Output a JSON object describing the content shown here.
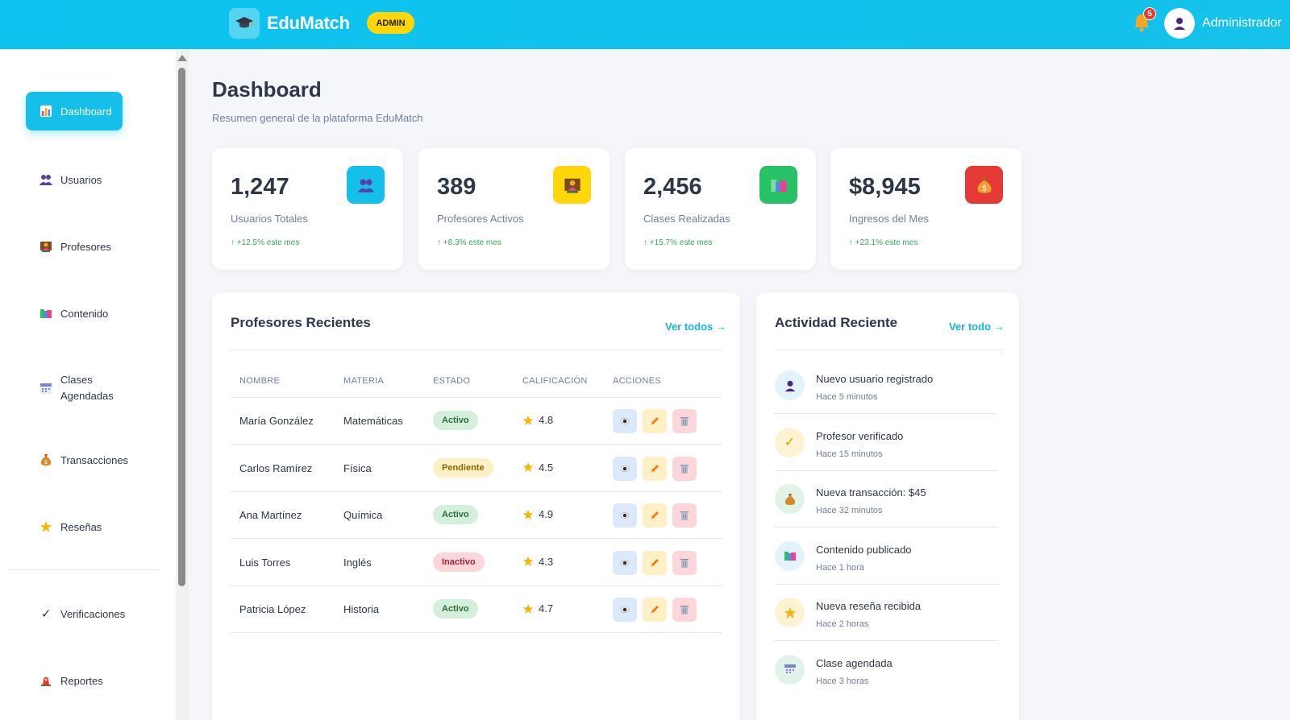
{
  "header": {
    "brand": "EduMatch",
    "badge": "ADMIN",
    "notifications_count": "5",
    "user_name": "Administrador"
  },
  "sidebar": {
    "items": [
      {
        "label": "Dashboard",
        "icon": "chart-icon",
        "active": true
      },
      {
        "label": "Usuarios",
        "icon": "users-icon"
      },
      {
        "label": "Profesores",
        "icon": "teacher-icon"
      },
      {
        "label": "Contenido",
        "icon": "books-icon"
      },
      {
        "label": "Clases\nAgendadas",
        "icon": "calendar-icon"
      },
      {
        "label": "Transacciones",
        "icon": "money-bag-icon"
      },
      {
        "label": "Reseñas",
        "icon": "star-icon"
      },
      {
        "label": "Verificaciones",
        "icon": "check-icon"
      },
      {
        "label": "Reportes",
        "icon": "alert-icon"
      }
    ]
  },
  "page": {
    "title": "Dashboard",
    "subtitle": "Resumen general de la plataforma EduMatch"
  },
  "stats": [
    {
      "value": "1,247",
      "label": "Usuarios Totales",
      "trend": "↑ +12.5% este mes",
      "color": "#14c0ea",
      "icon": "users-icon"
    },
    {
      "value": "389",
      "label": "Profesores Activos",
      "trend": "↑ +8.3% este mes",
      "color": "#ffd60a",
      "icon": "teacher-icon"
    },
    {
      "value": "2,456",
      "label": "Clases Realizadas",
      "trend": "↑ +15.7% este mes",
      "color": "#27c266",
      "icon": "books-icon"
    },
    {
      "value": "$8,945",
      "label": "Ingresos del Mes",
      "trend": "↑ +23.1% este mes",
      "color": "#e53935",
      "icon": "money-bag-icon"
    }
  ],
  "teachers": {
    "title": "Profesores Recientes",
    "link": "Ver todos →",
    "columns": [
      "NOMBRE",
      "MATERIA",
      "ESTADO",
      "CALIFICACIÓN",
      "ACCIONES"
    ],
    "rows": [
      {
        "name": "María González",
        "subject": "Matemáticas",
        "status": "Activo",
        "status_type": "active",
        "rating": "4.8"
      },
      {
        "name": "Carlos Ramírez",
        "subject": "Física",
        "status": "Pendiente",
        "status_type": "pending",
        "rating": "4.5"
      },
      {
        "name": "Ana Martínez",
        "subject": "Química",
        "status": "Activo",
        "status_type": "active",
        "rating": "4.9"
      },
      {
        "name": "Luis Torres",
        "subject": "Inglés",
        "status": "Inactivo",
        "status_type": "inactive",
        "rating": "4.3"
      },
      {
        "name": "Patricia López",
        "subject": "Historia",
        "status": "Activo",
        "status_type": "active",
        "rating": "4.7"
      }
    ]
  },
  "activity": {
    "title": "Actividad Reciente",
    "link": "Ver todo →",
    "items": [
      {
        "title": "Nuevo usuario registrado",
        "time": "Hace 5 minutos",
        "icon": "user-icon",
        "bg": "#e3f2fb"
      },
      {
        "title": "Profesor verificado",
        "time": "Hace 15 minutos",
        "icon": "check-icon",
        "bg": "#fdf3d3"
      },
      {
        "title": "Nueva transacción: $45",
        "time": "Hace 32 minutos",
        "icon": "money-bag-icon",
        "bg": "#e0f3e6"
      },
      {
        "title": "Contenido publicado",
        "time": "Hace 1 hora",
        "icon": "books-icon",
        "bg": "#e3f2fb"
      },
      {
        "title": "Nueva reseña recibida",
        "time": "Hace 2 horas",
        "icon": "star-icon",
        "bg": "#fdf3d3"
      },
      {
        "title": "Clase agendada",
        "time": "Hace 3 horas",
        "icon": "calendar-icon",
        "bg": "#e0f3e6"
      }
    ]
  }
}
